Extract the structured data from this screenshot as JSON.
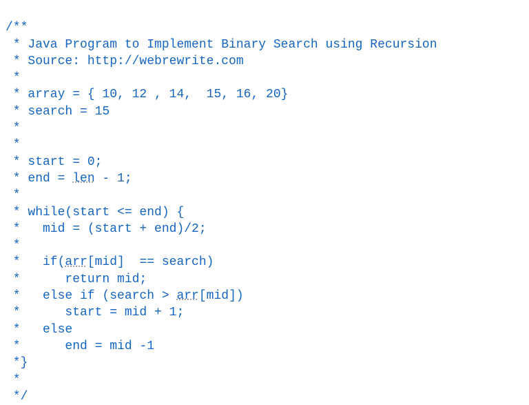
{
  "code": {
    "lines": [
      "/**",
      " * Java Program to Implement Binary Search using Recursion",
      " * Source: http://webrewrite.com",
      " *",
      " * array = { 10, 12 , 14,  15, 16, 20}",
      " * search = 15",
      " *",
      " *",
      " * start = 0;",
      " * end = ",
      " *",
      " * while(start <= end) {",
      " *   mid = (start + end)/2;",
      " *",
      " *   if(",
      " *      return mid;",
      " *   else if (search > ",
      " *      start = mid + 1;",
      " *   else",
      " *      end = mid -1",
      " *}",
      " *",
      " */"
    ],
    "special": {
      "len_text": "len",
      "len_suffix": " - 1;",
      "arr_text": "arr",
      "if_middle": "[mid]  == search)",
      "elseif_suffix": "[mid])"
    }
  }
}
